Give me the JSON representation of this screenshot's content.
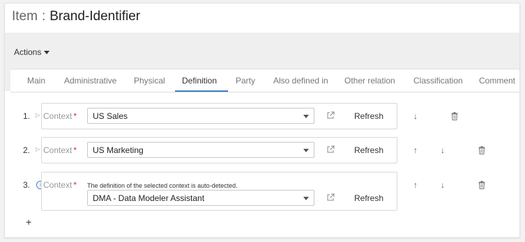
{
  "header": {
    "item_label": "Item",
    "separator": ":",
    "name": "Brand-Identifier"
  },
  "toolbar": {
    "actions_label": "Actions"
  },
  "tabs": [
    "Main",
    "Administrative",
    "Physical",
    "Definition",
    "Party",
    "Also defined in",
    "Other relation",
    "Classification",
    "Comment"
  ],
  "active_tab": "Definition",
  "accent_color": "#3a7fc6",
  "required_color": "#d0303a",
  "rows": [
    {
      "number": "1.",
      "context_label": "Context",
      "required_mark": "*",
      "value": "US Sales",
      "refresh_label": "Refresh",
      "note": ""
    },
    {
      "number": "2.",
      "context_label": "Context",
      "required_mark": "*",
      "value": "US Marketing",
      "refresh_label": "Refresh",
      "note": ""
    },
    {
      "number": "3.",
      "context_label": "Context",
      "required_mark": "*",
      "value": "DMA - Data Modeler Assistant",
      "refresh_label": "Refresh",
      "note": "The definition of the selected context is auto-detected."
    }
  ],
  "icons": {
    "expand": "triangle-right-icon",
    "external_link": "external-link-icon",
    "up": "arrow-up-icon",
    "down": "arrow-down-icon",
    "delete": "trash-icon",
    "info": "info-icon",
    "add": "plus-icon"
  },
  "glyphs": {
    "up": "↑",
    "down": "↓",
    "expand": "▷",
    "add": "+"
  }
}
